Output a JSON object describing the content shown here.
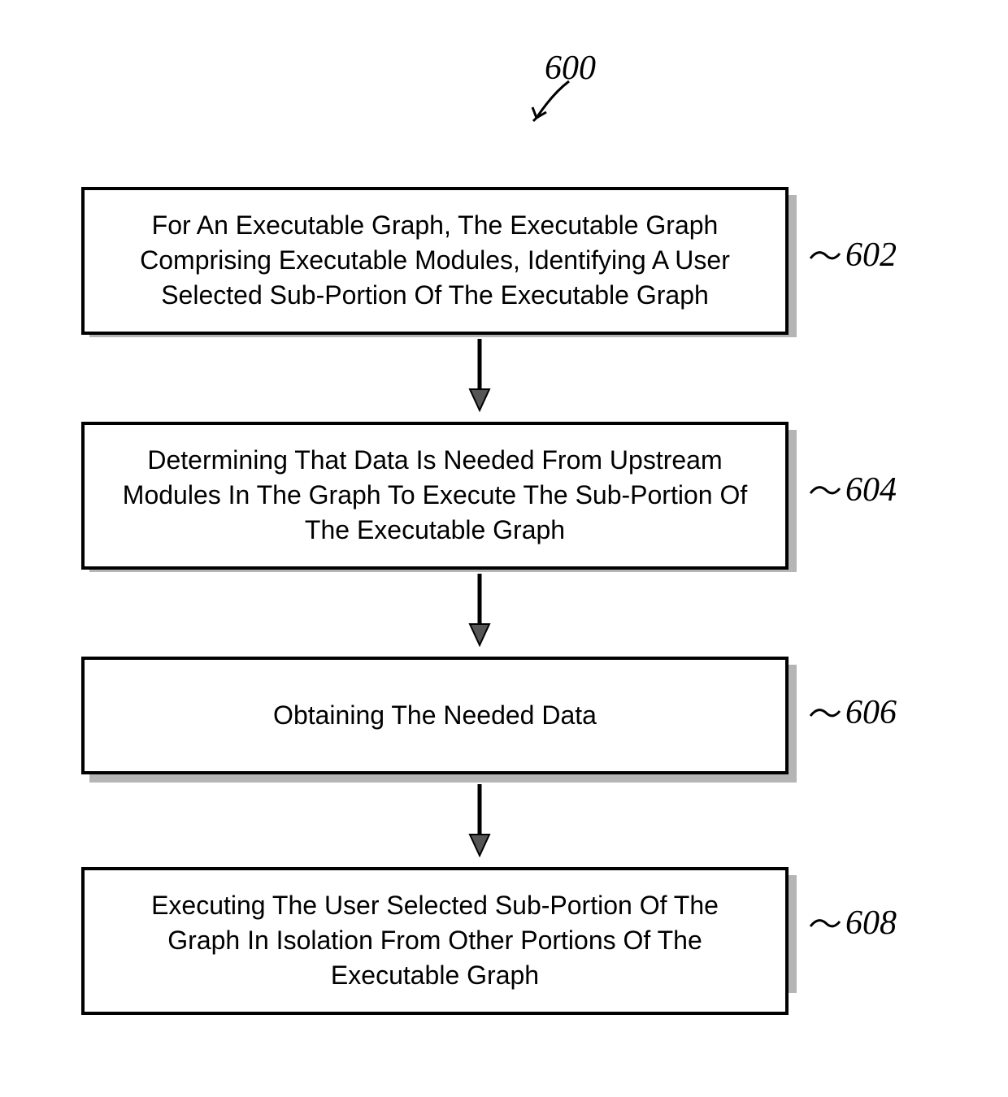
{
  "chart_data": {
    "type": "flowchart",
    "title_ref": "600",
    "steps": [
      {
        "ref": "602",
        "text": "For An Executable Graph, The Executable Graph Comprising Executable Modules, Identifying A User Selected Sub-Portion Of The Executable Graph"
      },
      {
        "ref": "604",
        "text": "Determining That Data Is Needed From Upstream Modules In The Graph To Execute The Sub-Portion Of The Executable Graph"
      },
      {
        "ref": "606",
        "text": "Obtaining The Needed Data"
      },
      {
        "ref": "608",
        "text": "Executing The User Selected Sub-Portion Of The Graph In Isolation From Other Portions Of The Executable Graph"
      }
    ],
    "edges": [
      {
        "from": "602",
        "to": "604"
      },
      {
        "from": "604",
        "to": "606"
      },
      {
        "from": "606",
        "to": "608"
      }
    ]
  }
}
